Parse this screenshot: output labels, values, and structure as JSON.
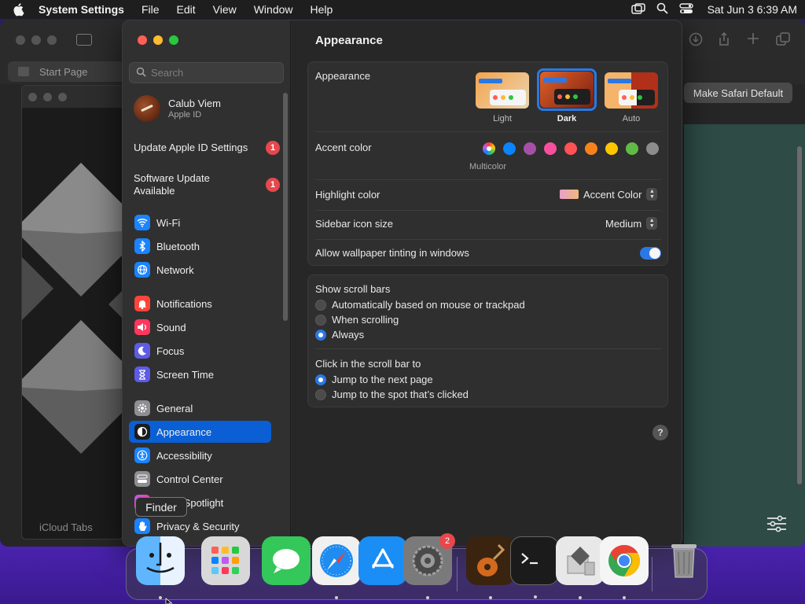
{
  "menubar": {
    "app_name": "System Settings",
    "menus": [
      "File",
      "Edit",
      "View",
      "Window",
      "Help"
    ],
    "clock": "Sat Jun 3  6:39 AM"
  },
  "safari": {
    "start_tab": "Start Page",
    "make_default": "Make Safari Default",
    "icloud_tabs": "iCloud Tabs"
  },
  "sidebar": {
    "search_placeholder": "Search",
    "account": {
      "name": "Calub Viem",
      "subtitle": "Apple ID"
    },
    "alerts": [
      {
        "label": "Update Apple ID Settings",
        "badge": "1"
      },
      {
        "label": "Software Update Available",
        "badge": "1"
      }
    ],
    "items": [
      {
        "label": "Wi-Fi",
        "color": "#1a84ff"
      },
      {
        "label": "Bluetooth",
        "color": "#1a84ff"
      },
      {
        "label": "Network",
        "color": "#1a84ff"
      },
      {
        "label": "Notifications",
        "color": "#ff453a"
      },
      {
        "label": "Sound",
        "color": "#ff375f"
      },
      {
        "label": "Focus",
        "color": "#5e5ce6"
      },
      {
        "label": "Screen Time",
        "color": "#5e5ce6"
      },
      {
        "label": "General",
        "color": "#8e8e93"
      },
      {
        "label": "Appearance",
        "color": "#1c1c1e"
      },
      {
        "label": "Accessibility",
        "color": "#1a84ff"
      },
      {
        "label": "Control Center",
        "color": "#8e8e93"
      },
      {
        "label": "Siri & Spotlight",
        "color": "#bf5af2"
      },
      {
        "label": "Privacy & Security",
        "color": "#1a84ff"
      }
    ],
    "selected": "Appearance"
  },
  "main": {
    "title": "Appearance",
    "appearance": {
      "label": "Appearance",
      "options": [
        "Light",
        "Dark",
        "Auto"
      ],
      "selected": "Dark"
    },
    "accent": {
      "label": "Accent color",
      "caption": "Multicolor",
      "colors": [
        "multicolor",
        "#0a84ff",
        "#a550a7",
        "#f74f9e",
        "#ff5257",
        "#f7821b",
        "#ffc600",
        "#62ba46",
        "#8c8c8c"
      ]
    },
    "highlight": {
      "label": "Highlight color",
      "value": "Accent Color"
    },
    "icon_size": {
      "label": "Sidebar icon size",
      "value": "Medium"
    },
    "tinting": {
      "label": "Allow wallpaper tinting in windows",
      "enabled": true
    },
    "scroll_bars": {
      "label": "Show scroll bars",
      "options": [
        "Automatically based on mouse or trackpad",
        "When scrolling",
        "Always"
      ],
      "selected": "Always"
    },
    "click_scroll": {
      "label": "Click in the scroll bar to",
      "options": [
        "Jump to the next page",
        "Jump to the spot that’s clicked"
      ],
      "selected": "Jump to the next page"
    },
    "help": "?"
  },
  "dock": {
    "tooltip": "Finder",
    "settings_badge": "2",
    "apps": [
      "Finder",
      "Launchpad",
      "Messages",
      "Safari",
      "App Store",
      "System Settings",
      "GarageBand",
      "Terminal",
      "Script Editor",
      "Google Chrome",
      "Trash"
    ]
  }
}
